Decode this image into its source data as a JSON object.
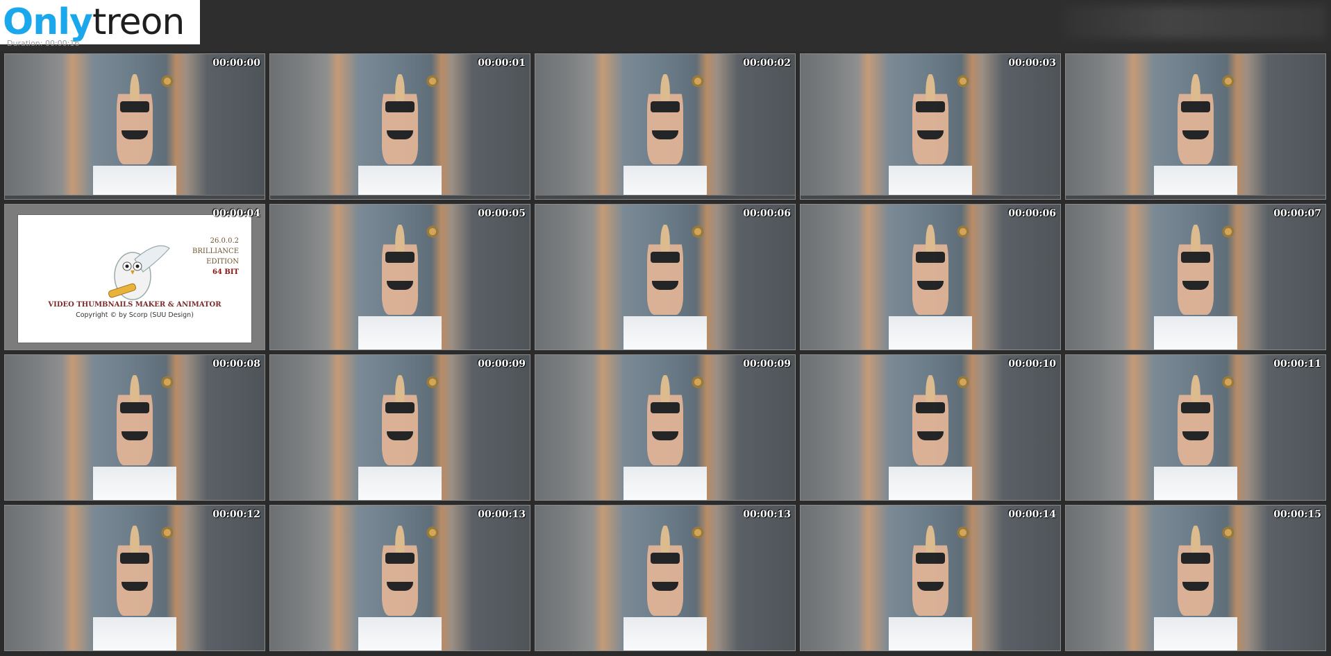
{
  "logo": {
    "part_a": "Only",
    "part_b": "treon"
  },
  "header": {
    "subinfo": "Duration: 00:00:16"
  },
  "splash": {
    "version": "26.0.0.2",
    "edition_1": "BRILLIANCE",
    "edition_2": "EDITION",
    "bits": "64 BIT",
    "product": "VIDEO THUMBNAILS MAKER & ANIMATOR",
    "copyright": "Copyright © by Scorp (SUU Design)"
  },
  "thumbnails": [
    {
      "tc": "00:00:00"
    },
    {
      "tc": "00:00:01"
    },
    {
      "tc": "00:00:02"
    },
    {
      "tc": "00:00:03"
    },
    {
      "tc": ""
    },
    {
      "tc": "00:00:04",
      "splash": true
    },
    {
      "tc": "00:00:05"
    },
    {
      "tc": "00:00:06"
    },
    {
      "tc": "00:00:06"
    },
    {
      "tc": "00:00:07"
    },
    {
      "tc": "00:00:08"
    },
    {
      "tc": "00:00:09"
    },
    {
      "tc": "00:00:09"
    },
    {
      "tc": "00:00:10"
    },
    {
      "tc": "00:00:11"
    },
    {
      "tc": "00:00:12"
    },
    {
      "tc": "00:00:13"
    },
    {
      "tc": "00:00:13"
    },
    {
      "tc": "00:00:14"
    },
    {
      "tc": "00:00:15"
    }
  ]
}
